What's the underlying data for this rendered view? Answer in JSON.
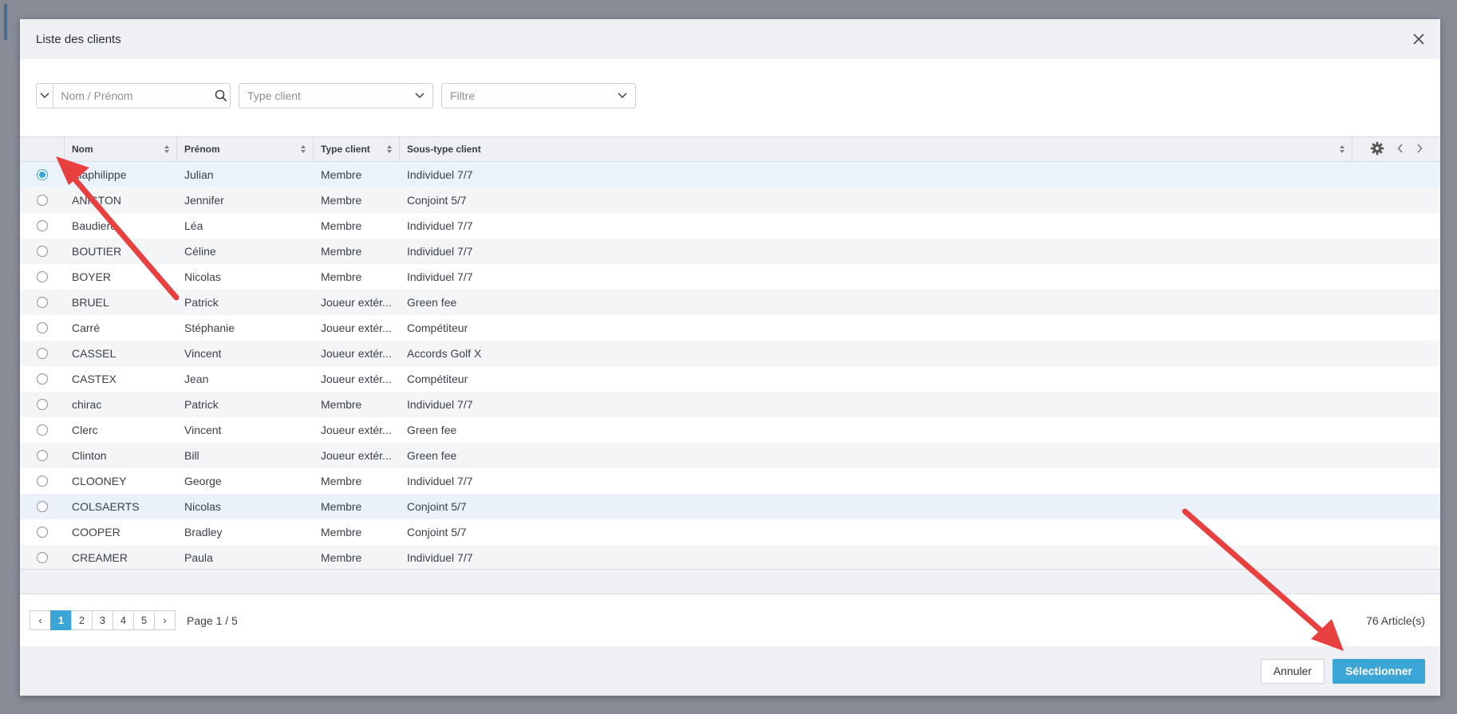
{
  "modal": {
    "title": "Liste des clients",
    "close_icon": "close-icon"
  },
  "toolbar": {
    "search_placeholder": "Nom / Prénom",
    "type_placeholder": "Type client",
    "filter_placeholder": "Filtre"
  },
  "grid": {
    "columns": [
      "Nom",
      "Prénom",
      "Type client",
      "Sous-type client"
    ],
    "rows": [
      {
        "nom": "Alaphilippe",
        "prenom": "Julian",
        "type": "Membre",
        "sous": "Individuel 7/7",
        "checked": true
      },
      {
        "nom": "ANISTON",
        "prenom": "Jennifer",
        "type": "Membre",
        "sous": "Conjoint 5/7"
      },
      {
        "nom": "Baudiero",
        "prenom": "Léa",
        "type": "Membre",
        "sous": "Individuel 7/7"
      },
      {
        "nom": "BOUTIER",
        "prenom": "Céline",
        "type": "Membre",
        "sous": "Individuel 7/7"
      },
      {
        "nom": "BOYER",
        "prenom": "Nicolas",
        "type": "Membre",
        "sous": "Individuel 7/7"
      },
      {
        "nom": "BRUEL",
        "prenom": "Patrick",
        "type": "Joueur extér...",
        "sous": "Green fee"
      },
      {
        "nom": "Carré",
        "prenom": "Stéphanie",
        "type": "Joueur extér...",
        "sous": "Compétiteur"
      },
      {
        "nom": "CASSEL",
        "prenom": "Vincent",
        "type": "Joueur extér...",
        "sous": "Accords Golf X"
      },
      {
        "nom": "CASTEX",
        "prenom": "Jean",
        "type": "Joueur extér...",
        "sous": "Compétiteur"
      },
      {
        "nom": "chirac",
        "prenom": "Patrick",
        "type": "Membre",
        "sous": "Individuel 7/7"
      },
      {
        "nom": "Clerc",
        "prenom": "Vincent",
        "type": "Joueur extér...",
        "sous": "Green fee"
      },
      {
        "nom": "Clinton",
        "prenom": "Bill",
        "type": "Joueur extér...",
        "sous": "Green fee"
      },
      {
        "nom": "CLOONEY",
        "prenom": "George",
        "type": "Membre",
        "sous": "Individuel 7/7"
      },
      {
        "nom": "COLSAERTS",
        "prenom": "Nicolas",
        "type": "Membre",
        "sous": "Conjoint 5/7",
        "highlighted": true
      },
      {
        "nom": "COOPER",
        "prenom": "Bradley",
        "type": "Membre",
        "sous": "Conjoint 5/7"
      },
      {
        "nom": "CREAMER",
        "prenom": "Paula",
        "type": "Membre",
        "sous": "Individuel 7/7"
      }
    ]
  },
  "pager": {
    "prev": "‹",
    "next": "›",
    "pages": [
      "1",
      "2",
      "3",
      "4",
      "5"
    ],
    "active_page": "1",
    "page_info": "Page 1 / 5",
    "count": "76 Article(s)"
  },
  "footer": {
    "cancel_label": "Annuler",
    "select_label": "Sélectionner"
  },
  "colors": {
    "accent": "#3ba5d6",
    "annotation_arrow": "#e8403f"
  }
}
